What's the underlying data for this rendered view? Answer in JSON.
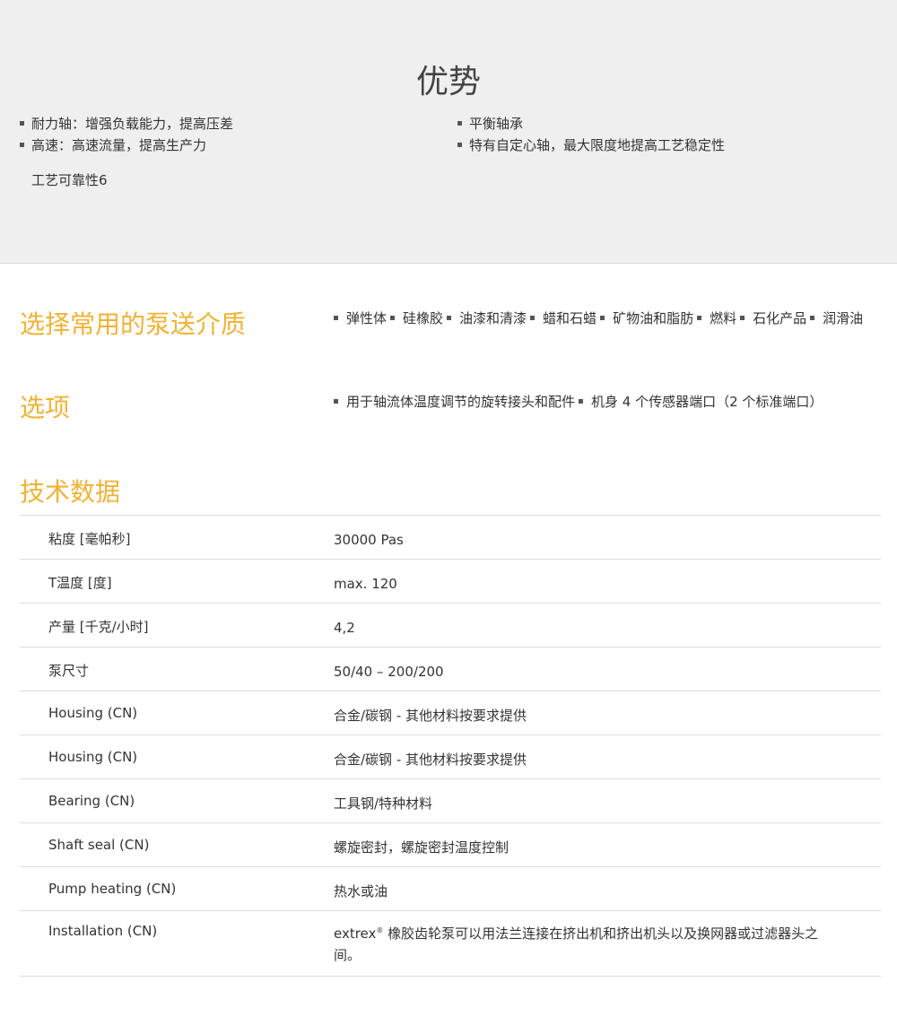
{
  "advantages": {
    "title": "优势",
    "left": [
      "耐力轴：增强负载能力，提高压差",
      "高速：高速流量，提高生产力"
    ],
    "right": [
      "平衡轴承",
      "特有自定心轴，最大限度地提高工艺稳定性"
    ],
    "note": "工艺可靠性6"
  },
  "media": {
    "title": "选择常用的泵送介质",
    "items": [
      "弹性体",
      "硅橡胶",
      "油漆和清漆",
      "蜡和石蜡",
      "矿物油和脂肪",
      "燃料",
      "石化产品",
      "润滑油"
    ]
  },
  "options": {
    "title": "选项",
    "items": [
      "用于轴流体温度调节的旋转接头和配件",
      "机身 4 个传感器端口（2 个标准端口）"
    ]
  },
  "tech": {
    "title": "技术数据",
    "rows": [
      {
        "key": "粘度 [毫帕秒]",
        "value": "30000 Pas"
      },
      {
        "key": "T温度 [度]",
        "value": "max. 120"
      },
      {
        "key": "产量 [千克/小时]",
        "value": "4,2"
      },
      {
        "key": "泵尺寸",
        "value": "50/40 – 200/200"
      },
      {
        "key": "Housing (CN)",
        "value": "合金/碳钢 - 其他材料按要求提供"
      },
      {
        "key": "Housing (CN)",
        "value": "合金/碳钢 - 其他材料按要求提供"
      },
      {
        "key": "Bearing (CN)",
        "value": "工具钢/特种材料"
      },
      {
        "key": "Shaft seal (CN)",
        "value": "螺旋密封，螺旋密封温度控制"
      },
      {
        "key": "Pump heating (CN)",
        "value": "热水或油"
      },
      {
        "key": "Installation (CN)",
        "value_brand": "extrex",
        "value_mark": "®",
        "value": " 橡胶齿轮泵可以用法兰连接在挤出机和挤出机头以及换网器或过滤器头之间。"
      }
    ]
  }
}
